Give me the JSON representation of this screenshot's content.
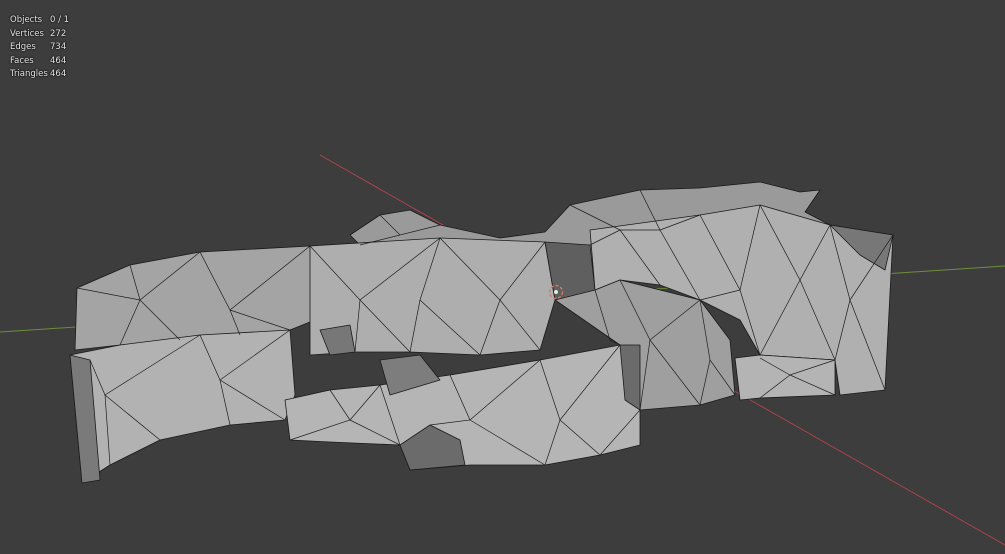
{
  "viewport": {
    "background": "#3d3d3d",
    "mesh_face_color": "#a7a7a7",
    "mesh_shadow_color": "#5a5a5a",
    "wire_color": "#1a1a1a",
    "x_axis_color": "#b5434f",
    "y_axis_color": "#6f8f3c"
  },
  "stats": {
    "objects_label": "Objects",
    "objects_value": "0 / 1",
    "vertices_label": "Vertices",
    "vertices_value": "272",
    "edges_label": "Edges",
    "edges_value": "734",
    "faces_label": "Faces",
    "faces_value": "464",
    "triangles_label": "Triangles",
    "triangles_value": "464"
  }
}
